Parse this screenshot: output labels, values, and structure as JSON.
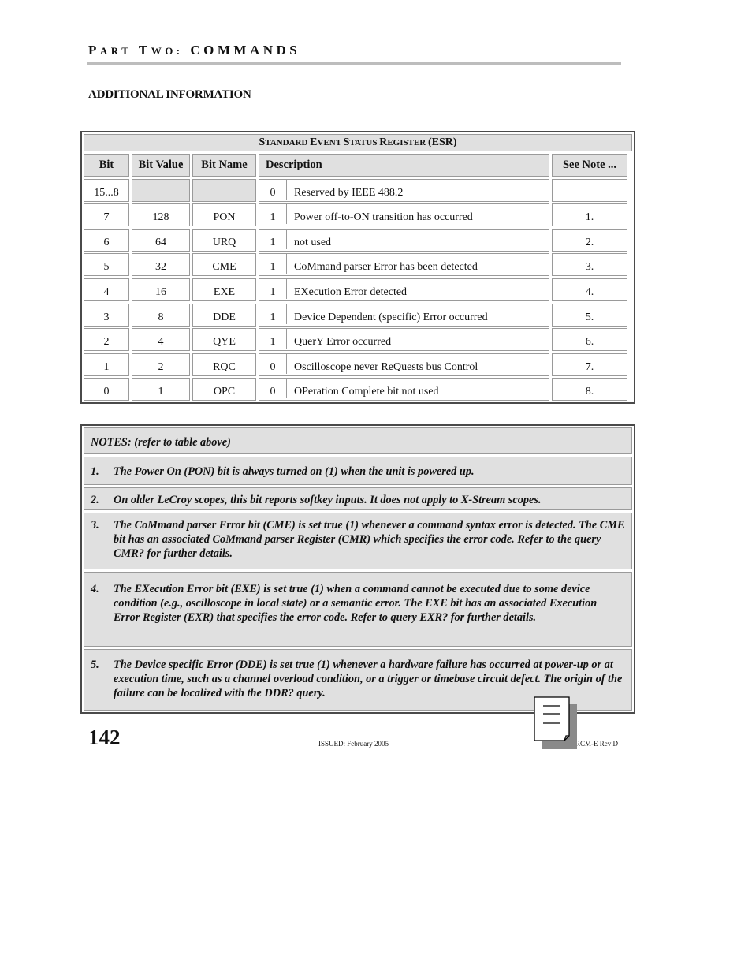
{
  "header": {
    "part_initial_1": "P",
    "part_rest_1": "ART",
    "part_initial_2": "T",
    "part_rest_2": "WO:",
    "section": "COMMANDS"
  },
  "section_title": "ADDITIONAL INFORMATION",
  "esr_table": {
    "title_parts": [
      {
        "initial": "S",
        "rest": "TANDARD "
      },
      {
        "initial": "E",
        "rest": "VENT "
      },
      {
        "initial": "S",
        "rest": "TATUS "
      },
      {
        "initial": "R",
        "rest": "EGISTER "
      }
    ],
    "title_suffix": "(ESR)",
    "headers": {
      "bit": "Bit",
      "bit_value": "Bit Value",
      "bit_name": "Bit Name",
      "description": "Description",
      "see_note": "See Note ..."
    },
    "rows": [
      {
        "bit": "15...8",
        "bit_value": "",
        "bit_name": "",
        "flag": "0",
        "description": "Reserved by IEEE 488.2",
        "note": ""
      },
      {
        "bit": "7",
        "bit_value": "128",
        "bit_name": "PON",
        "flag": "1",
        "description": "Power off-to-ON transition has occurred",
        "note": "1."
      },
      {
        "bit": "6",
        "bit_value": "64",
        "bit_name": "URQ",
        "flag": "1",
        "description": "not used",
        "note": "2."
      },
      {
        "bit": "5",
        "bit_value": "32",
        "bit_name": "CME",
        "flag": "1",
        "description": "CoMmand parser Error has been detected",
        "note": "3."
      },
      {
        "bit": "4",
        "bit_value": "16",
        "bit_name": "EXE",
        "flag": "1",
        "description": "EXecution Error detected",
        "note": "4."
      },
      {
        "bit": "3",
        "bit_value": "8",
        "bit_name": "DDE",
        "flag": "1",
        "description": "Device Dependent (specific) Error occurred",
        "note": "5."
      },
      {
        "bit": "2",
        "bit_value": "4",
        "bit_name": "QYE",
        "flag": "1",
        "description": "QuerY Error occurred",
        "note": "6."
      },
      {
        "bit": "1",
        "bit_value": "2",
        "bit_name": "RQC",
        "flag": "0",
        "description": "Oscilloscope never ReQuests bus Control",
        "note": "7."
      },
      {
        "bit": "0",
        "bit_value": "1",
        "bit_name": "OPC",
        "flag": "0",
        "description": "OPeration Complete bit not used",
        "note": "8."
      }
    ]
  },
  "notes": {
    "heading_label": "NOTES:",
    "heading_rest": " (refer to table above)",
    "items": [
      {
        "num": "1.",
        "text": "The Power On (PON) bit is always turned on (1) when the unit is powered up."
      },
      {
        "num": "2.",
        "text": "On older LeCroy scopes, this bit reports softkey inputs. It does not apply to X-Stream scopes."
      },
      {
        "num": "3.",
        "text": "The CoMmand parser Error bit (CME) is set true (1) whenever a command syntax error is detected. The CME bit has an associated CoMmand parser Register (CMR) which specifies the error code. Refer to the query CMR? for further details."
      },
      {
        "num": "4.",
        "text": "The EXecution Error bit (EXE) is set true (1) when a command cannot be executed due to some device condition (e.g., oscilloscope in local state) or a semantic error. The EXE bit has an associated Execution Error Register (EXR) that specifies the error code. Refer to query EXR? for further details."
      },
      {
        "num": "5.",
        "text": "The Device specific Error (DDE) is set true (1) whenever a hardware failure has occurred at power-up or at execution time, such as a channel overload condition, or a trigger or timebase circuit defect. The origin of the failure can be localized with the DDR? query."
      }
    ]
  },
  "footer": {
    "page_number": "142",
    "issued": "ISSUED: February 2005",
    "revision": "RCM-E Rev D",
    "icon": "document-icon"
  }
}
